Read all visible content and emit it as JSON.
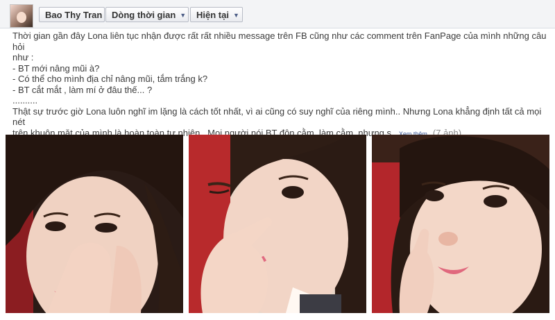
{
  "header": {
    "profile_name": "Bao Thy Tran",
    "timeline_label": "Dòng thời gian",
    "present_label": "Hiện tại"
  },
  "post": {
    "line1": "Thời gian gần đây Lona liên tục nhận được rất rất nhiều message trên FB cũng như các comment trên FanPage của mình những câu hỏi",
    "line2": "như :",
    "line3": "- BT mới nâng mũi à?",
    "line4": "- Có thể cho mình địa chỉ nâng mũi, tắm trắng k?",
    "line5": "- BT cắt mắt , làm mí ở đâu thế... ?",
    "line6": "..........",
    "line7": "Thật sự trước giờ Lona luôn nghĩ im lặng là cách tốt nhất, vì ai cũng có suy nghĩ của riêng mình.. Nhưng Lona khẳng định tất cả mọi nét",
    "line8": "trên khuôn mặt của mình là hoàn toàn tự nhiên.. Mọi người nói BT độn cằm, làm cằm, nhưng s...",
    "see_more": "Xem thêm",
    "photo_count": "(7 ảnh)"
  },
  "icons": {
    "dropdown": "caret-down-icon"
  }
}
